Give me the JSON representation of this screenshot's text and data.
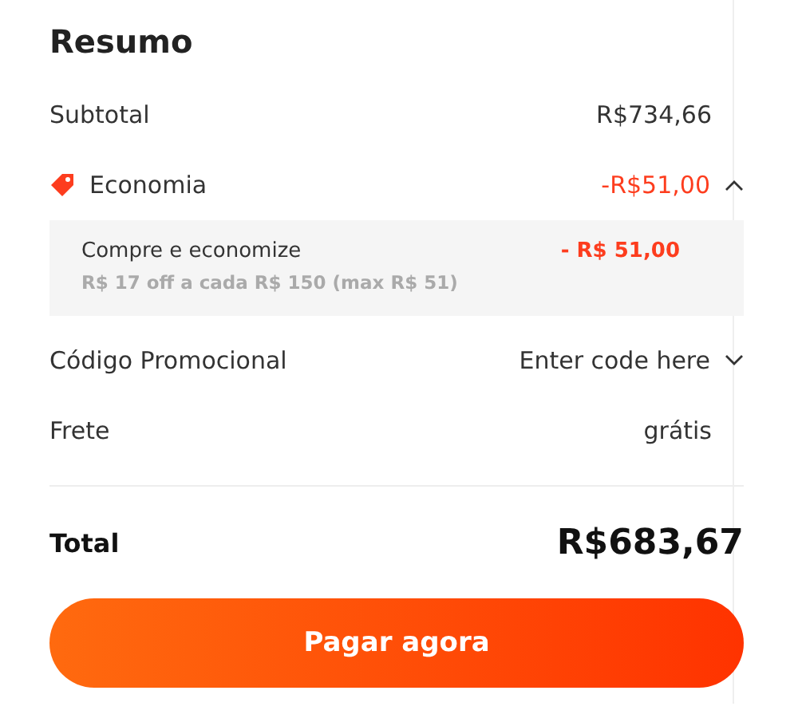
{
  "title": "Resumo",
  "subtotal": {
    "label": "Subtotal",
    "value": "R$734,66"
  },
  "savings": {
    "label": "Economia",
    "value": "-R$51,00",
    "expanded": true,
    "details": [
      {
        "title": "Compre e economize",
        "note": "R$ 17 off a cada R$ 150 (max R$ 51)",
        "value": "- R$ 51,00"
      }
    ]
  },
  "promo_code": {
    "label": "Código Promocional",
    "placeholder": "Enter code here",
    "expanded": false
  },
  "shipping": {
    "label": "Frete",
    "value": "grátis"
  },
  "total": {
    "label": "Total",
    "value": "R$683,67"
  },
  "pay_button": "Pagar agora"
}
